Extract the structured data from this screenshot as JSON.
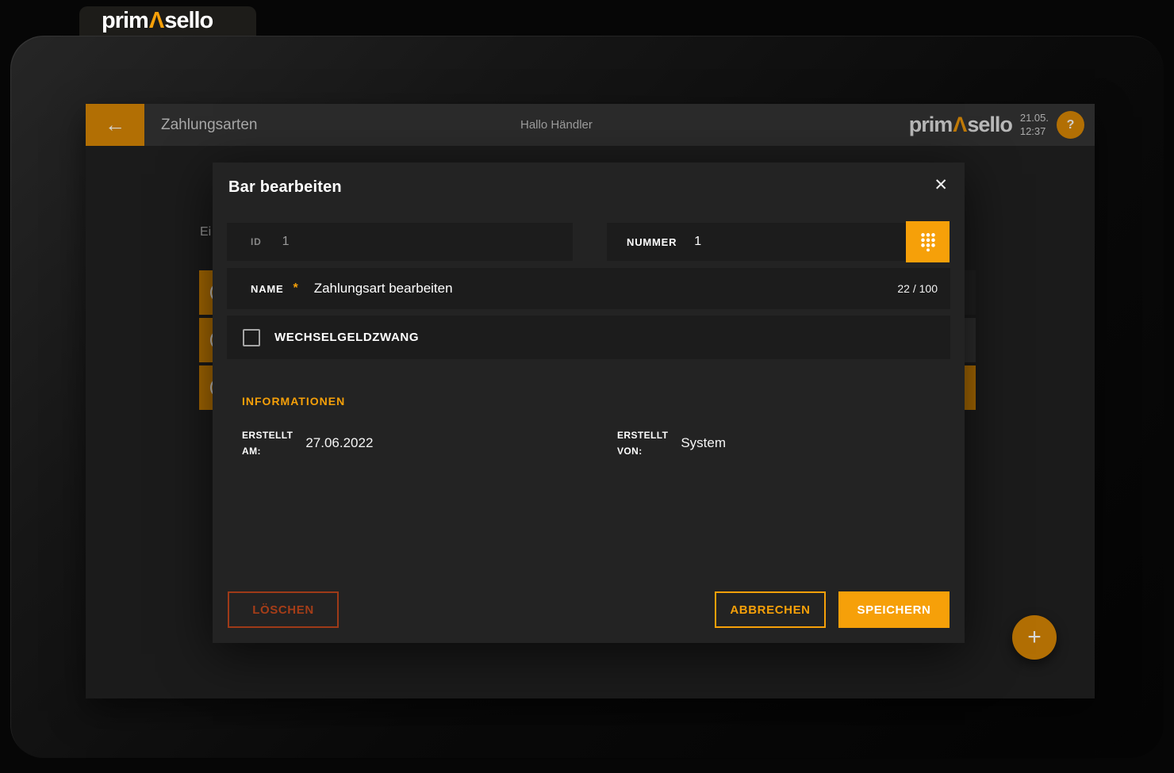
{
  "brand": {
    "name_prefix": "prim",
    "name_lambda": "Λ",
    "name_suffix": "sello"
  },
  "header": {
    "title": "Zahlungsarten",
    "greeting": "Hallo Händler",
    "date": "21.05.",
    "time": "12:37"
  },
  "icons": {
    "back": "←",
    "help": "?",
    "close": "✕",
    "plus": "+"
  },
  "page": {
    "visible_text_fragment": "Ei"
  },
  "dialog": {
    "title": "Bar bearbeiten",
    "id_label": "ID",
    "id_value": "1",
    "nummer_label": "NUMMER",
    "nummer_value": "1",
    "name_label": "NAME",
    "required_mark": "*",
    "name_value": "Zahlungsart bearbeiten",
    "name_counter": "22 / 100",
    "checkbox_label": "WECHSELGELDZWANG",
    "checkbox_checked": false,
    "info_heading": "INFORMATIONEN",
    "created_am_line1": "ERSTELLT",
    "created_am_line2": "AM:",
    "created_am_value": "27.06.2022",
    "created_von_line1": "ERSTELLT",
    "created_von_line2": "VON:",
    "created_von_value": "System",
    "delete_label": "LÖSCHEN",
    "cancel_label": "ABBRECHEN",
    "save_label": "SPEICHERN"
  },
  "colors": {
    "accent": "#F6A009",
    "accent_dimmed": "#B26F04",
    "danger": "#A53D18"
  }
}
